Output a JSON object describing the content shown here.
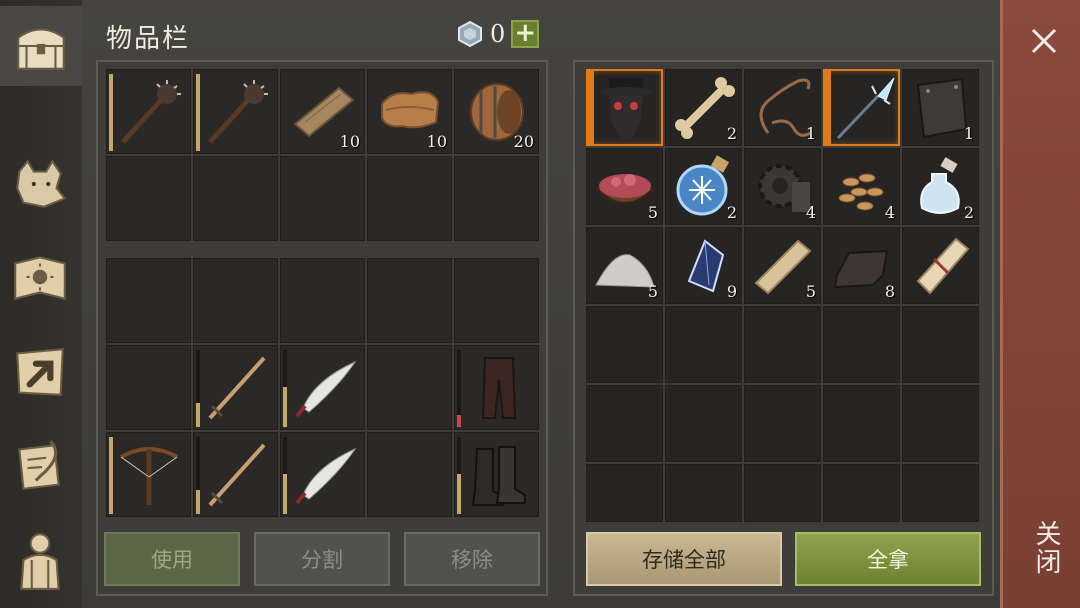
{
  "header": {
    "title": "物品栏",
    "currency_value": "0",
    "add_label": "+"
  },
  "sidebar": {
    "tabs": [
      {
        "name": "inventory",
        "icon": "chest-icon",
        "active": true
      },
      {
        "name": "wolf",
        "icon": "wolf-icon",
        "active": false
      },
      {
        "name": "skills",
        "icon": "sun-book-icon",
        "active": false
      },
      {
        "name": "crafting",
        "icon": "map-arrow-icon",
        "active": false
      },
      {
        "name": "quests",
        "icon": "scroll-feather-icon",
        "active": false
      },
      {
        "name": "character",
        "icon": "backpack-icon",
        "active": false
      }
    ]
  },
  "inventory": {
    "row1": [
      {
        "item": "spiked-mace-icon",
        "qty": "",
        "durability": 1.0
      },
      {
        "item": "spiked-mace-icon",
        "qty": "",
        "durability": 1.0
      },
      {
        "item": "wood-plank-icon",
        "qty": "10"
      },
      {
        "item": "leather-icon",
        "qty": "10"
      },
      {
        "item": "barrel-icon",
        "qty": "20"
      }
    ],
    "equipped": [
      {
        "item": "sword-icon",
        "durability": 0.3
      },
      {
        "item": "scimitar-icon",
        "durability": 0.5
      },
      {
        "item": "pants-icon",
        "durability": 0.15,
        "low": true
      },
      {
        "item": "crossbow-icon",
        "durability": 1.0
      },
      {
        "item": "sword-icon",
        "durability": 0.3
      },
      {
        "item": "scimitar-icon",
        "durability": 0.5
      },
      {
        "item": "boots-icon",
        "durability": 0.5
      }
    ]
  },
  "chest": {
    "items": [
      {
        "item": "plague-mask-icon",
        "qty": "",
        "selected": true
      },
      {
        "item": "bone-icon",
        "qty": "2"
      },
      {
        "item": "rope-icon",
        "qty": "1"
      },
      {
        "item": "frost-spear-icon",
        "qty": "",
        "selected": true
      },
      {
        "item": "chest-armor-icon",
        "qty": "1"
      },
      {
        "item": "raw-meat-bowl-icon",
        "qty": "5"
      },
      {
        "item": "frost-orb-icon",
        "qty": "2"
      },
      {
        "item": "gear-icon",
        "qty": "4"
      },
      {
        "item": "seeds-icon",
        "qty": "4"
      },
      {
        "item": "potion-icon",
        "qty": "2"
      },
      {
        "item": "powder-pile-icon",
        "qty": "5"
      },
      {
        "item": "crystal-icon",
        "qty": "9"
      },
      {
        "item": "plank-icon",
        "qty": "5"
      },
      {
        "item": "iron-ingot-icon",
        "qty": "8"
      },
      {
        "item": "scroll-icon",
        "qty": ""
      }
    ]
  },
  "buttons": {
    "use": "使用",
    "split": "分割",
    "remove": "移除",
    "store_all": "存储全部",
    "take_all": "全拿"
  },
  "close": {
    "label": "关闭"
  },
  "colors": {
    "accent": "#e07b18",
    "take_all": "#7d9240",
    "close_bar": "#843f33"
  }
}
